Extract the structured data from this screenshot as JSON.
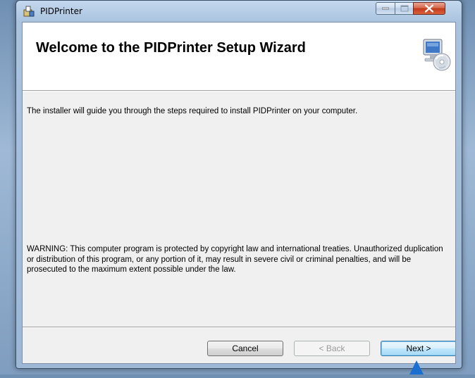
{
  "window": {
    "title": "PIDPrinter"
  },
  "banner": {
    "title": "Welcome to the PIDPrinter Setup Wizard",
    "icon": "computer-cd-icon"
  },
  "body": {
    "intro": "The installer will guide you through the steps required to install PIDPrinter on your computer.",
    "warning": "WARNING: This computer program is protected by copyright law and international treaties. Unauthorized duplication or distribution of this program, or any portion of it, may result in severe civil or criminal penalties, and will be prosecuted to the maximum extent possible under the law."
  },
  "buttons": {
    "cancel": "Cancel",
    "back": "< Back",
    "next": "Next >"
  },
  "colors": {
    "accent": "#3c7fb1",
    "close": "#c2391b",
    "cursor": "#1b6fd1"
  }
}
